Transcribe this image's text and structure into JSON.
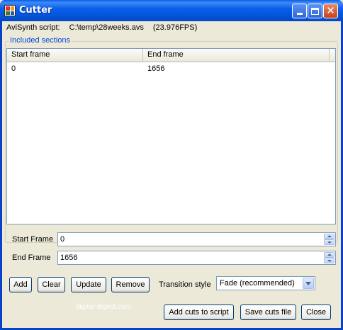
{
  "window": {
    "title": "Cutter",
    "icon": "cutter-app-icon"
  },
  "script_info": {
    "label": "AviSynth script:",
    "path": "C:\\temp\\28weeks.avs",
    "fps": "(23.976FPS)"
  },
  "sections": {
    "legend": "Included sections",
    "columns": [
      "Start frame",
      "End frame"
    ],
    "rows": [
      {
        "start": "0",
        "end": "1656"
      }
    ]
  },
  "fields": {
    "start_frame": {
      "label": "Start Frame",
      "value": "0"
    },
    "end_frame": {
      "label": "End Frame",
      "value": "1656"
    }
  },
  "buttons": {
    "add": "Add",
    "clear": "Clear",
    "update": "Update",
    "remove": "Remove",
    "add_cuts": "Add cuts to script",
    "save_cuts": "Save cuts file",
    "close": "Close"
  },
  "transition": {
    "label": "Transition style",
    "selected": "Fade (recommended)"
  },
  "watermark": "digital-digest.com",
  "colors": {
    "titlebar": "#0356dc",
    "legend": "#0046d5",
    "face": "#ece9d8"
  }
}
